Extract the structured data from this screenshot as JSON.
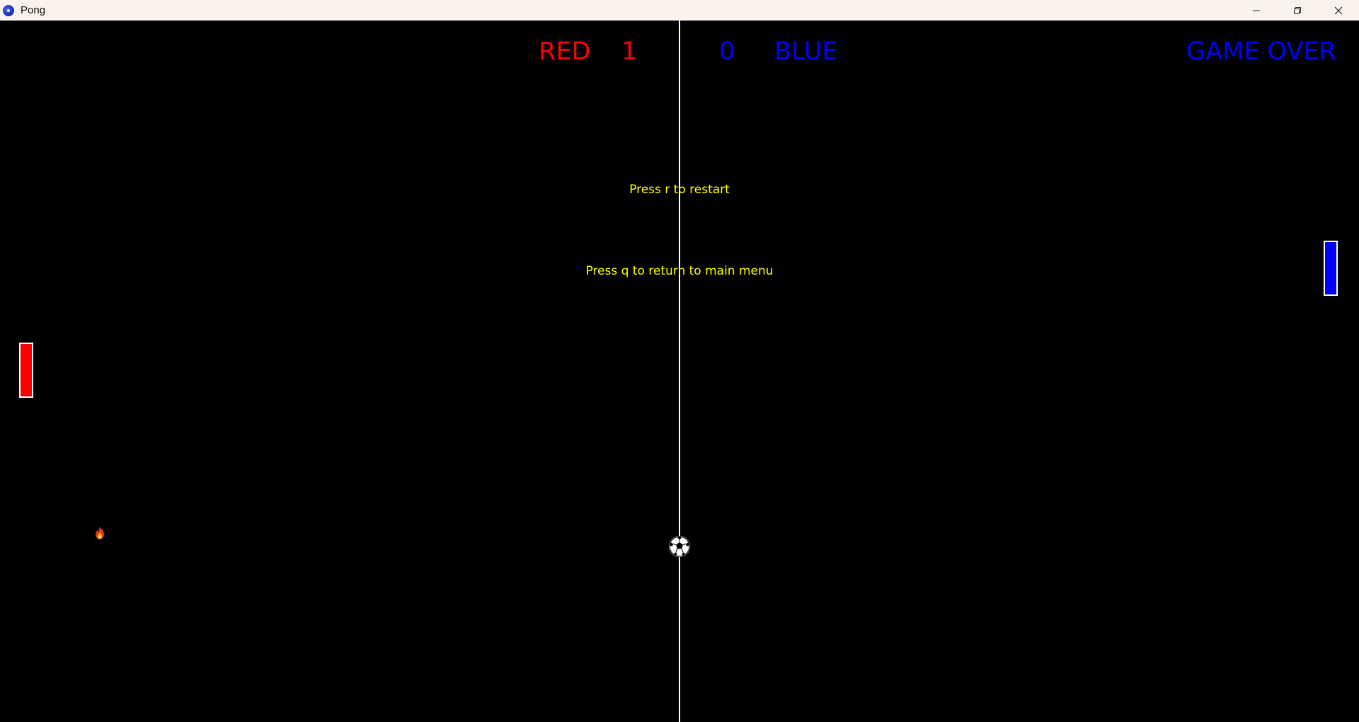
{
  "window": {
    "title": "Pong",
    "controls": {
      "minimize": "minimize-icon",
      "restore": "restore-icon",
      "close": "close-icon"
    }
  },
  "game": {
    "red_label": "RED",
    "red_score": "1",
    "blue_score": "0",
    "blue_label": "BLUE",
    "status": "GAME OVER",
    "restart_hint": "Press r to restart",
    "menu_hint": "Press q to return to main menu"
  },
  "colors": {
    "red": "#ff0000",
    "blue": "#0000ff",
    "hint": "#ffff00",
    "background": "#000000",
    "center_line": "#ffffff"
  },
  "icons": {
    "ball": "soccer-ball-icon",
    "powerup": "fire-icon"
  }
}
